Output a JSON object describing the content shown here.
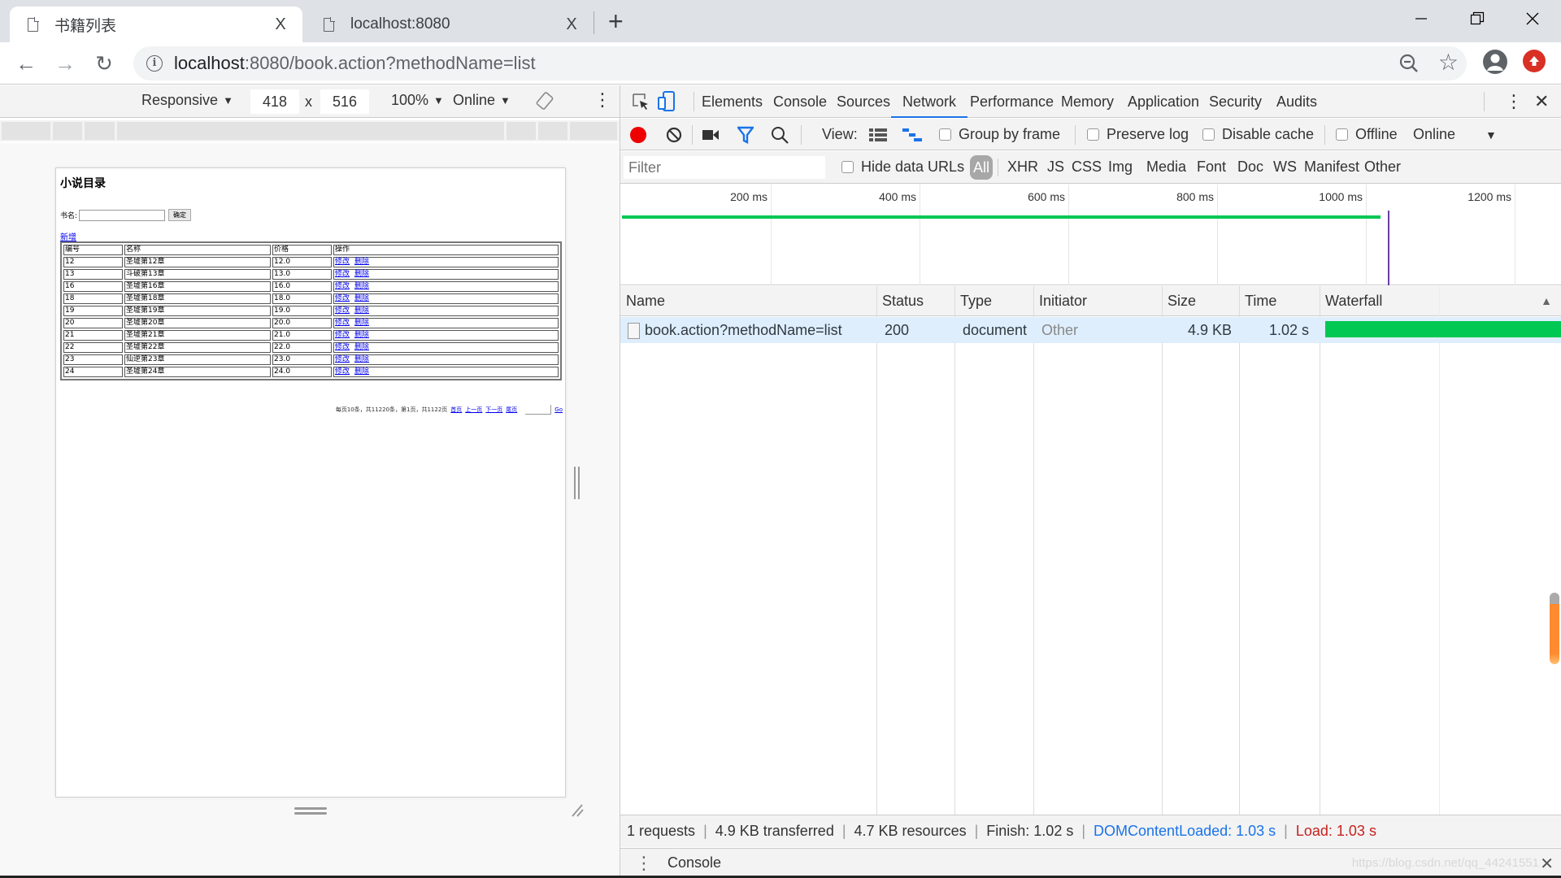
{
  "browser": {
    "tabs": [
      {
        "title": "书籍列表",
        "active": true,
        "close": "X"
      },
      {
        "title": "localhost:8080",
        "active": false,
        "close": "X"
      }
    ],
    "new_tab": "+",
    "url_host": "localhost",
    "url_rest": ":8080/book.action?methodName=list",
    "icons": {
      "back": "back-arrow-icon",
      "forward": "forward-arrow-icon",
      "reload": "reload-icon",
      "info": "info-icon",
      "zoom": "zoom-out-icon",
      "bookmark": "star-icon",
      "profile": "profile-icon",
      "update": "update-icon"
    },
    "back_glyph": "←",
    "forward_glyph": "→",
    "reload_glyph": "↻",
    "info_glyph": "i",
    "star_glyph": "☆"
  },
  "device_toolbar": {
    "device": "Responsive",
    "width": "418",
    "times": "x",
    "height": "516",
    "zoom": "100%",
    "network": "Online",
    "caret": "▼",
    "more": "⋮"
  },
  "page": {
    "title": "小说目录",
    "search_label": "书名:",
    "search_value": "",
    "search_button": "确定",
    "add_link": "新增",
    "table_headers": [
      "编号",
      "名称",
      "价格",
      "操作"
    ],
    "rows": [
      {
        "id": "12",
        "name": "圣墟第12章",
        "price": "12.0"
      },
      {
        "id": "13",
        "name": "斗破第13章",
        "price": "13.0"
      },
      {
        "id": "16",
        "name": "圣墟第16章",
        "price": "16.0"
      },
      {
        "id": "18",
        "name": "圣墟第18章",
        "price": "18.0"
      },
      {
        "id": "19",
        "name": "圣墟第19章",
        "price": "19.0"
      },
      {
        "id": "20",
        "name": "圣墟第20章",
        "price": "20.0"
      },
      {
        "id": "21",
        "name": "圣墟第21章",
        "price": "21.0"
      },
      {
        "id": "22",
        "name": "圣墟第22章",
        "price": "22.0"
      },
      {
        "id": "23",
        "name": "仙逆第23章",
        "price": "23.0"
      },
      {
        "id": "24",
        "name": "圣墟第24章",
        "price": "24.0"
      }
    ],
    "edit_label": "修改",
    "delete_label": "删除",
    "pager": {
      "info": "每页10条，共11220条，第1页，共1122页",
      "first": "首页",
      "prev": "上一页",
      "next": "下一页",
      "last": "尾页",
      "go": "Go"
    }
  },
  "devtools": {
    "panels": [
      "Elements",
      "Console",
      "Sources",
      "Network",
      "Performance",
      "Memory",
      "Application",
      "Security",
      "Audits"
    ],
    "active_panel": "Network",
    "close": "✕",
    "more": "⋮",
    "toolbar": {
      "view_label": "View:",
      "group_by_frame": "Group by frame",
      "preserve_log": "Preserve log",
      "disable_cache": "Disable cache",
      "offline": "Offline",
      "throttle": "Online",
      "caret": "▼"
    },
    "filter": {
      "placeholder": "Filter",
      "hide_data_urls": "Hide data URLs",
      "types": [
        "All",
        "XHR",
        "JS",
        "CSS",
        "Img",
        "Media",
        "Font",
        "Doc",
        "WS",
        "Manifest",
        "Other"
      ],
      "active_type": "All"
    },
    "overview": {
      "ticks": [
        "200 ms",
        "400 ms",
        "600 ms",
        "800 ms",
        "1000 ms",
        "1200 ms"
      ],
      "request_end_ms": 1020,
      "load_marker_ms": 1030,
      "green_color": "#00c853",
      "marker_color": "#6b3fa0"
    },
    "columns": [
      "Name",
      "Status",
      "Type",
      "Initiator",
      "Size",
      "Time",
      "Waterfall"
    ],
    "sort_glyph": "▲",
    "requests": [
      {
        "name": "book.action?methodName=list",
        "status": "200",
        "type": "document",
        "initiator": "Other",
        "size": "4.9 KB",
        "time": "1.02 s"
      }
    ],
    "summary": {
      "requests": "1 requests",
      "transferred": "4.9 KB transferred",
      "resources": "4.7 KB resources",
      "finish": "Finish: 1.02 s",
      "dcl": "DOMContentLoaded: 1.03 s",
      "load": "Load: 1.03 s",
      "dcl_color": "#1a73e8",
      "load_color": "#c5221f"
    },
    "drawer": {
      "tab": "Console",
      "close": "✕"
    },
    "watermark": "https://blog.csdn.net/qq_44241551"
  }
}
